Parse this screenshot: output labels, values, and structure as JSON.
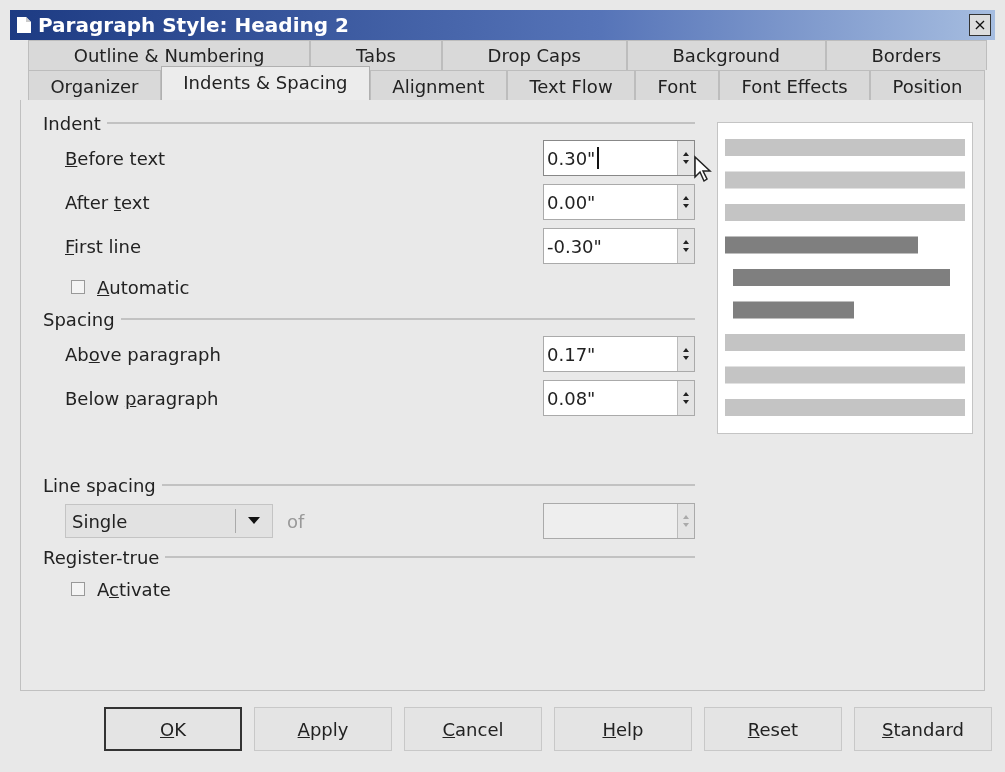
{
  "window": {
    "title": "Paragraph Style: Heading 2",
    "close": "×"
  },
  "tab_rows": [
    [
      {
        "label": "Outline & Numbering",
        "selected": false
      },
      {
        "label": "Tabs",
        "selected": false
      },
      {
        "label": "Drop Caps",
        "selected": false
      },
      {
        "label": "Background",
        "selected": false
      },
      {
        "label": "Borders",
        "selected": false
      }
    ],
    [
      {
        "label": "Organizer",
        "selected": false
      },
      {
        "label": "Indents & Spacing",
        "selected": true
      },
      {
        "label": "Alignment",
        "selected": false
      },
      {
        "label": "Text Flow",
        "selected": false
      },
      {
        "label": "Font",
        "selected": false
      },
      {
        "label": "Font Effects",
        "selected": false
      },
      {
        "label": "Position",
        "selected": false
      }
    ]
  ],
  "sections": [
    {
      "title": "Indent",
      "rows": [
        {
          "kind": "spin",
          "label": {
            "key": "B",
            "post": "efore text"
          },
          "value": "0.30\"",
          "focused": true,
          "disabled": false
        },
        {
          "kind": "spin",
          "label": {
            "pre": "After ",
            "key": "t",
            "post": "ext"
          },
          "value": "0.00\"",
          "focused": false,
          "disabled": false
        },
        {
          "kind": "spin",
          "label": {
            "key": "F",
            "post": "irst line"
          },
          "value": "-0.30\"",
          "focused": false,
          "disabled": false
        },
        {
          "kind": "check",
          "label": {
            "key": "A",
            "post": "utomatic"
          },
          "checked": false
        }
      ]
    },
    {
      "title": "Spacing",
      "rows": [
        {
          "kind": "spin",
          "label": {
            "pre": "Ab",
            "key": "o",
            "post": "ve paragraph"
          },
          "value": "0.17\"",
          "focused": false,
          "disabled": false
        },
        {
          "kind": "spin",
          "label": {
            "pre": "Below ",
            "key": "p",
            "post": "aragraph"
          },
          "value": "0.08\"",
          "focused": false,
          "disabled": false
        }
      ]
    },
    {
      "title": "Line spacing",
      "rows": [
        {
          "kind": "combo",
          "value": "Single",
          "of_label": "of",
          "of_disabled": true,
          "spin": {
            "disabled": true,
            "focused": false
          }
        }
      ]
    },
    {
      "title": "Register-true",
      "rows": [
        {
          "kind": "check",
          "label": {
            "pre": "A",
            "key": "c",
            "post": "tivate"
          },
          "checked": false
        }
      ]
    }
  ],
  "buttons": [
    {
      "label": {
        "key": "O",
        "post": "K"
      },
      "default": true
    },
    {
      "label": {
        "key": "A",
        "post": "pply"
      },
      "default": false
    },
    {
      "label": {
        "key": "C",
        "post": "ancel"
      },
      "default": false
    },
    {
      "label": {
        "key": "H",
        "post": "elp"
      },
      "default": false
    },
    {
      "label": {
        "key": "R",
        "post": "eset"
      },
      "default": false
    },
    {
      "label": {
        "key": "S",
        "post": "tandard"
      },
      "default": false
    }
  ]
}
